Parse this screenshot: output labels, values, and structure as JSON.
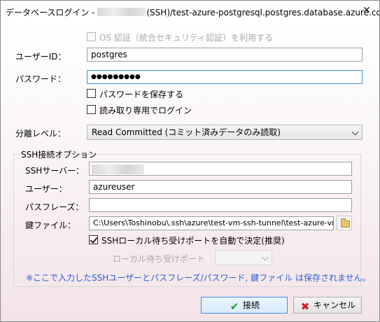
{
  "window": {
    "title_prefix": "データベースログイン - ",
    "title_suffix": "(SSH)/test-azure-postgresql.postgres.database.azure.com/p...",
    "close_glyph": "✕"
  },
  "auth": {
    "os_auth_label": "OS 認証（統合セキュリティ認証）を利用する",
    "os_auth_checked": false
  },
  "login": {
    "user_id_label": "ユーザーID：",
    "user_id_value": "postgres",
    "password_label": "パスワード：",
    "password_value": "●●●●●●●●●",
    "save_password_label": "パスワードを保存する",
    "save_password_checked": false,
    "read_only_label": "読み取り専用でログイン",
    "read_only_checked": false
  },
  "isolation": {
    "label": "分離レベル：",
    "selected": "Read Committed (コミット済みデータのみ読取)"
  },
  "ssh": {
    "group_title": "SSH接続オプション",
    "server_label": "SSHサーバー：",
    "user_label": "ユーザー：",
    "user_value": "azureuser",
    "passphrase_label": "パスフレーズ：",
    "passphrase_value": "",
    "key_file_label": "鍵ファイル：",
    "key_file_value": "C:\\Users\\Toshinobu\\.ssh\\azure\\test-vm-ssh-tunnel\\test-azure-vr",
    "auto_port_label": "SSHローカル待ち受けポートを自動で決定(推奨)",
    "auto_port_checked": true,
    "local_port_label": "ローカル待ち受けポート",
    "local_port_value": ""
  },
  "note": "※ここで入力したSSHユーザーとパスフレーズ/パスワード, 鍵ファイル は保存されません。",
  "buttons": {
    "connect_label": "接続",
    "cancel_label": "キャンセル"
  },
  "icons": {
    "connect": "check-icon",
    "cancel": "x-icon",
    "browse": "folder-icon",
    "close": "close-icon"
  },
  "colors": {
    "accent": "#3c8fdc",
    "note_text": "#2b5fd9",
    "connect_icon": "#1a9b2c",
    "cancel_icon": "#d41f1f"
  }
}
